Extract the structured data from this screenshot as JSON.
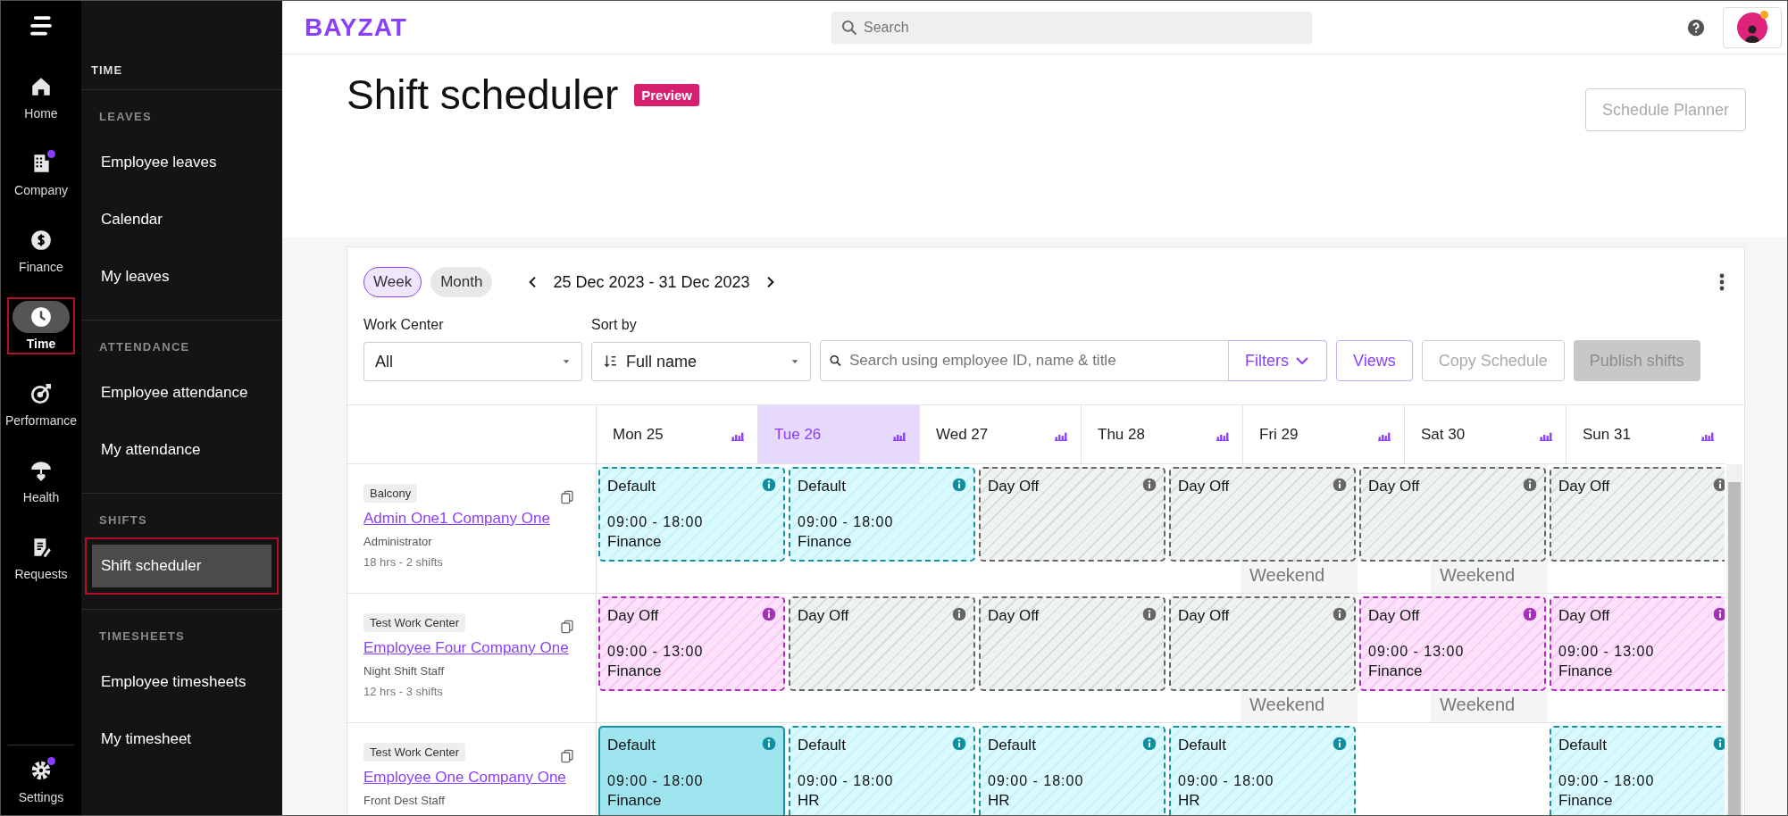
{
  "rail": {
    "items": [
      {
        "label": "Home",
        "selected": false,
        "badge": false,
        "annotated": false
      },
      {
        "label": "Company",
        "selected": false,
        "badge": true,
        "annotated": false
      },
      {
        "label": "Finance",
        "selected": false,
        "badge": false,
        "annotated": false
      },
      {
        "label": "Time",
        "selected": true,
        "badge": false,
        "annotated": true
      },
      {
        "label": "Performance",
        "selected": false,
        "badge": false,
        "annotated": false
      },
      {
        "label": "Health",
        "selected": false,
        "badge": false,
        "annotated": false
      },
      {
        "label": "Requests",
        "selected": false,
        "badge": false,
        "annotated": false
      }
    ],
    "settings": {
      "label": "Settings",
      "badge": true
    }
  },
  "sidebar": {
    "title": "TIME",
    "sections": [
      {
        "heading": "LEAVES",
        "items": [
          {
            "label": "Employee leaves",
            "selected": false,
            "annotated": false
          },
          {
            "label": "Calendar",
            "selected": false,
            "annotated": false
          },
          {
            "label": "My leaves",
            "selected": false,
            "annotated": false
          }
        ]
      },
      {
        "heading": "ATTENDANCE",
        "items": [
          {
            "label": "Employee attendance",
            "selected": false,
            "annotated": false
          },
          {
            "label": "My attendance",
            "selected": false,
            "annotated": false
          }
        ]
      },
      {
        "heading": "SHIFTS",
        "items": [
          {
            "label": "Shift scheduler",
            "selected": true,
            "annotated": true
          }
        ]
      },
      {
        "heading": "TIMESHEETS",
        "items": [
          {
            "label": "Employee timesheets",
            "selected": false,
            "annotated": false
          },
          {
            "label": "My timesheet",
            "selected": false,
            "annotated": false
          }
        ]
      }
    ]
  },
  "header": {
    "logo": "BAYZAT",
    "search": {
      "placeholder": "Search"
    },
    "notification": true
  },
  "page": {
    "title": "Shift scheduler",
    "badge": "Preview",
    "action": "Schedule Planner"
  },
  "toolbar": {
    "views": [
      {
        "label": "Week",
        "selected": true
      },
      {
        "label": "Month",
        "selected": false
      }
    ],
    "date_range": "25 Dec 2023 - 31 Dec 2023",
    "work_center": {
      "label": "Work Center",
      "value": "All"
    },
    "sort_by": {
      "label": "Sort by",
      "value": "Full name"
    },
    "search": {
      "placeholder": "Search using employee ID, name & title"
    },
    "buttons": [
      {
        "label": "Filters",
        "kind": "dropdown",
        "disabled": false
      },
      {
        "label": "Views",
        "kind": "outline",
        "disabled": false
      },
      {
        "label": "Copy Schedule",
        "kind": "outline",
        "disabled": true
      },
      {
        "label": "Publish shifts",
        "kind": "filled",
        "disabled": true
      }
    ]
  },
  "days": [
    {
      "label": "Mon 25",
      "selected": false
    },
    {
      "label": "Tue 26",
      "selected": true
    },
    {
      "label": "Wed 27",
      "selected": false
    },
    {
      "label": "Thu 28",
      "selected": false
    },
    {
      "label": "Fri 29",
      "selected": false
    },
    {
      "label": "Sat 30",
      "selected": false
    },
    {
      "label": "Sun 31",
      "selected": false
    }
  ],
  "employees": [
    {
      "tag": "Balcony",
      "name": "Admin One1 Company One",
      "role": "Administrator",
      "summary": "18 hrs - 2 shifts",
      "cells": [
        {
          "shift": {
            "kind": "work",
            "title": "Default",
            "time": "09:00 - 18:00",
            "department": "Finance",
            "selected": false
          }
        },
        {
          "shift": {
            "kind": "work",
            "title": "Default",
            "time": "09:00 - 18:00",
            "department": "Finance",
            "selected": false
          }
        },
        {
          "shift": {
            "kind": "off",
            "title": "Day Off",
            "selected": false
          }
        },
        {
          "shift": {
            "kind": "off",
            "title": "Day Off",
            "selected": false
          },
          "note": "Weekend"
        },
        {
          "shift": {
            "kind": "off",
            "title": "Day Off",
            "selected": false
          },
          "note": "Weekend"
        },
        {
          "shift": {
            "kind": "off",
            "title": "Day Off",
            "selected": false
          }
        }
      ]
    },
    {
      "tag": "Test Work Center",
      "name": "Employee Four Company One",
      "role": "Night Shift Staff",
      "summary": "12 hrs - 3 shifts",
      "cells": [
        {
          "shift": {
            "kind": "leave",
            "title": "Day Off",
            "time": "09:00 - 13:00",
            "department": "Finance",
            "selected": false
          }
        },
        {
          "shift": {
            "kind": "off",
            "title": "Day Off",
            "selected": false
          }
        },
        {
          "shift": {
            "kind": "off",
            "title": "Day Off",
            "selected": false
          }
        },
        {
          "shift": {
            "kind": "off",
            "title": "Day Off",
            "selected": false
          },
          "note": "Weekend"
        },
        {
          "shift": {
            "kind": "leave",
            "title": "Day Off",
            "time": "09:00 - 13:00",
            "department": "Finance",
            "selected": false
          },
          "note": "Weekend"
        },
        {
          "shift": {
            "kind": "leave",
            "title": "Day Off",
            "time": "09:00 - 13:00",
            "department": "Finance",
            "selected": false
          }
        }
      ]
    },
    {
      "tag": "Test Work Center",
      "name": "Employee One Company One",
      "role": "Front Dest Staff",
      "cells": [
        {
          "shift": {
            "kind": "work",
            "title": "Default",
            "time": "09:00 - 18:00",
            "department": "Finance",
            "selected": true
          }
        },
        {
          "shift": {
            "kind": "work",
            "title": "Default",
            "time": "09:00 - 18:00",
            "department": "HR",
            "selected": false
          }
        },
        {
          "shift": {
            "kind": "work",
            "title": "Default",
            "time": "09:00 - 18:00",
            "department": "HR",
            "selected": false
          }
        },
        {
          "shift": {
            "kind": "work",
            "title": "Default",
            "time": "09:00 - 18:00",
            "department": "HR",
            "selected": false
          }
        },
        {},
        {
          "shift": {
            "kind": "work",
            "title": "Default",
            "time": "09:00 - 18:00",
            "department": "Finance",
            "selected": false
          }
        }
      ]
    }
  ]
}
